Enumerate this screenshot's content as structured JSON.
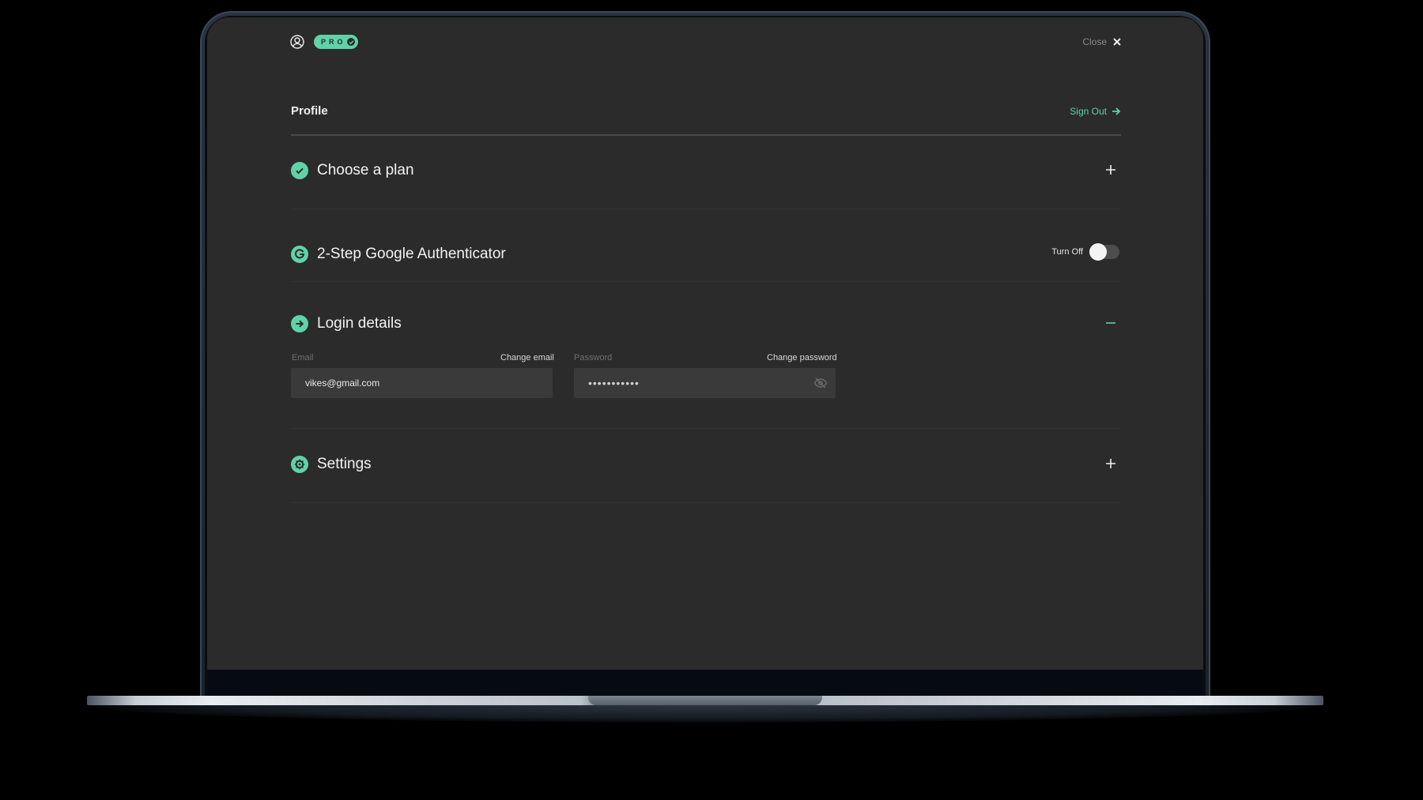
{
  "header": {
    "badge": "PRO",
    "close_label": "Close"
  },
  "profile": {
    "title": "Profile",
    "sign_out_label": "Sign Out"
  },
  "sections": {
    "plan": {
      "title": "Choose a plan",
      "icon": "check-circle-icon",
      "action": "expand"
    },
    "auth": {
      "title": "2-Step Google Authenticator",
      "icon": "google-icon",
      "toggle_label": "Turn Off",
      "enabled": false
    },
    "login": {
      "title": "Login details",
      "icon": "arrow-circle-icon",
      "action": "collapse",
      "email_label": "Email",
      "change_email": "Change email",
      "email_value": "vikes@gmail.com",
      "password_label": "Password",
      "change_password": "Change password",
      "password_value": "•••••••••••"
    },
    "settings": {
      "title": "Settings",
      "icon": "gear-icon",
      "action": "expand"
    }
  },
  "colors": {
    "accent": "#5fd3a8",
    "background": "#2b2b2b",
    "input_bg": "#3a3a3a"
  }
}
